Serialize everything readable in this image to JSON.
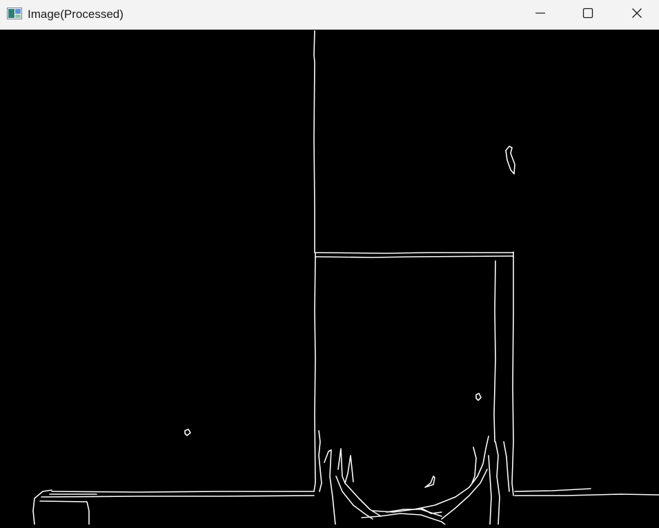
{
  "window": {
    "title": "Image(Processed)",
    "controls": [
      "minimize",
      "maximize",
      "close"
    ]
  },
  "image": {
    "description_type": "edge-detected binary image",
    "background_color": "#000000",
    "edge_color": "#ffffff"
  },
  "icons": {
    "app": "image-window-icon",
    "minimize": "minimize-icon",
    "maximize": "maximize-icon",
    "close": "close-icon"
  }
}
